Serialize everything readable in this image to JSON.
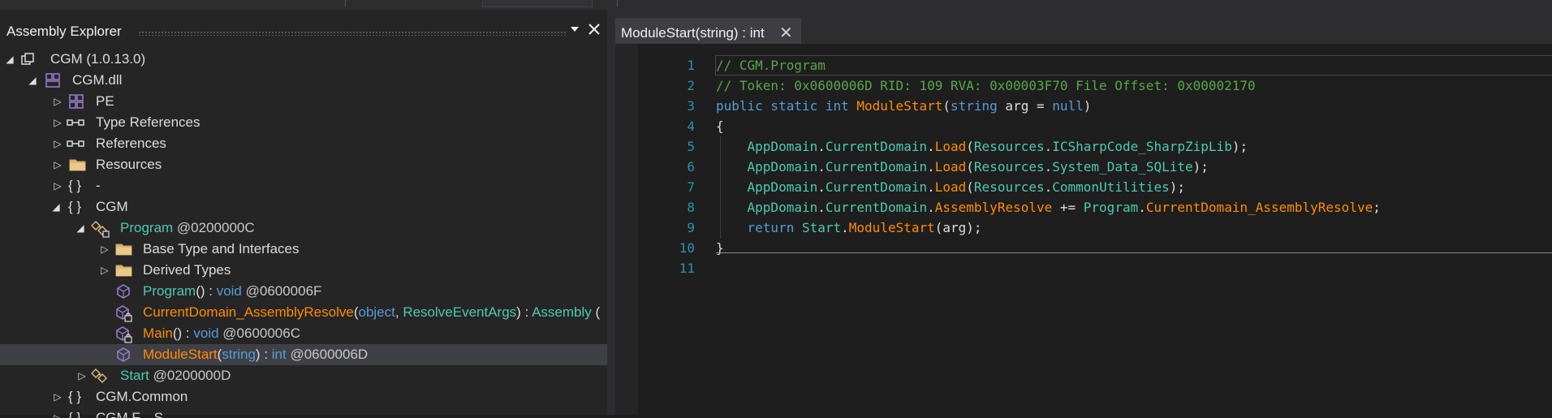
{
  "assembly_explorer": {
    "title": "Assembly Explorer",
    "dropdown_icon": "triangle-down",
    "close_icon": "x",
    "tree": [
      {
        "name": "asm",
        "label": "CGM (1.0.13.0)",
        "icon": "assembly-icon",
        "expanded": true
      },
      {
        "name": "module",
        "label": "CGM.dll",
        "icon": "module-icon",
        "expanded": true
      },
      {
        "name": "pe",
        "label": "PE",
        "icon": "grid-icon",
        "expanded": false
      },
      {
        "name": "typerefs",
        "label": "Type References",
        "icon": "reference-icon",
        "expanded": false
      },
      {
        "name": "refs",
        "label": "References",
        "icon": "reference-icon",
        "expanded": false
      },
      {
        "name": "resources",
        "label": "Resources",
        "icon": "folder-icon",
        "expanded": false
      },
      {
        "name": "ns-dash",
        "label": "-",
        "icon": "namespace-icon",
        "expanded": false
      },
      {
        "name": "ns-cgm",
        "label": "CGM",
        "icon": "namespace-icon",
        "expanded": true
      },
      {
        "name": "program",
        "label": "Program",
        "token": "@0200000C",
        "icon": "class-icon",
        "expanded": true
      },
      {
        "name": "basetypes",
        "label": "Base Type and Interfaces",
        "icon": "folder-icon",
        "expanded": false
      },
      {
        "name": "derived",
        "label": "Derived Types",
        "icon": "folder-icon",
        "expanded": false
      },
      {
        "name": "m-ctor",
        "method": "Program",
        "sep": " : ",
        "ret": "void",
        "token": "@0600006F",
        "icon": "method-icon"
      },
      {
        "name": "m-resolve",
        "method": "CurrentDomain_AssemblyResolve",
        "p1": "object",
        "p2": "ResolveEventArgs",
        "sep": " : ",
        "ret": "Assembly",
        "tail": "(",
        "icon": "private-method-icon"
      },
      {
        "name": "m-main",
        "method": "Main",
        "sep": " : ",
        "ret": "void",
        "token": "@0600006C",
        "icon": "private-method-icon"
      },
      {
        "name": "m-modulestart",
        "method": "ModuleStart",
        "p1": "string",
        "sep": " : ",
        "ret": "int",
        "token": "@0600006D",
        "icon": "method-icon",
        "selected": true
      },
      {
        "name": "start",
        "label": "Start",
        "token": "@0200000D",
        "icon": "class-icon",
        "expanded": false
      },
      {
        "name": "ns-common",
        "label": "CGM.Common",
        "icon": "namespace-icon",
        "expanded": false
      },
      {
        "name": "ns-partial",
        "label": "CGM.F....S....",
        "icon": "namespace-icon",
        "expanded": false
      }
    ],
    "glyphs": {
      "collapsed": "▷",
      "expanded": "◢",
      "ns": "{ }",
      "paren_open": "(",
      "paren_close": ")",
      "comma": ", ",
      "empty_parens": "()"
    }
  },
  "editor": {
    "tab_label": "ModuleStart(string) : int",
    "tab_close": "✕",
    "lines": [
      {
        "n": "1"
      },
      {
        "n": "2"
      },
      {
        "n": "3"
      },
      {
        "n": "4"
      },
      {
        "n": "5"
      },
      {
        "n": "6"
      },
      {
        "n": "7"
      },
      {
        "n": "8"
      },
      {
        "n": "9"
      },
      {
        "n": "10"
      },
      {
        "n": "11"
      }
    ],
    "code": {
      "l1": "// CGM.Program",
      "l2": "// Token: 0x0600006D RID: 109 RVA: 0x00003F70 File Offset: 0x00002170",
      "l3_kw": "public static int ",
      "l3_meth": "ModuleStart",
      "l3_open": "(",
      "l3_kw2": "string",
      "l3_arg": " arg = ",
      "l3_null": "null",
      "l3_close": ")",
      "open_brace": "{",
      "close_brace": "}",
      "appdomain": "AppDomain",
      "dot": ".",
      "currentdomain": "CurrentDomain",
      "load": "Load",
      "paren_open": "(",
      "resources": "Resources",
      "res1": "ICSharpCode_SharpZipLib",
      "res2": "System_Data_SQLite",
      "res3": "CommonUtilities",
      "end_call": ");",
      "assemblyresolve": "AssemblyResolve",
      "plus_eq": " += ",
      "program": "Program",
      "handler": "CurrentDomain_AssemblyResolve",
      "semicolon": ";",
      "indent": "    ",
      "return_kw": "return ",
      "start": "Start",
      "modulestart": "ModuleStart",
      "ret_args": "(arg);"
    }
  }
}
